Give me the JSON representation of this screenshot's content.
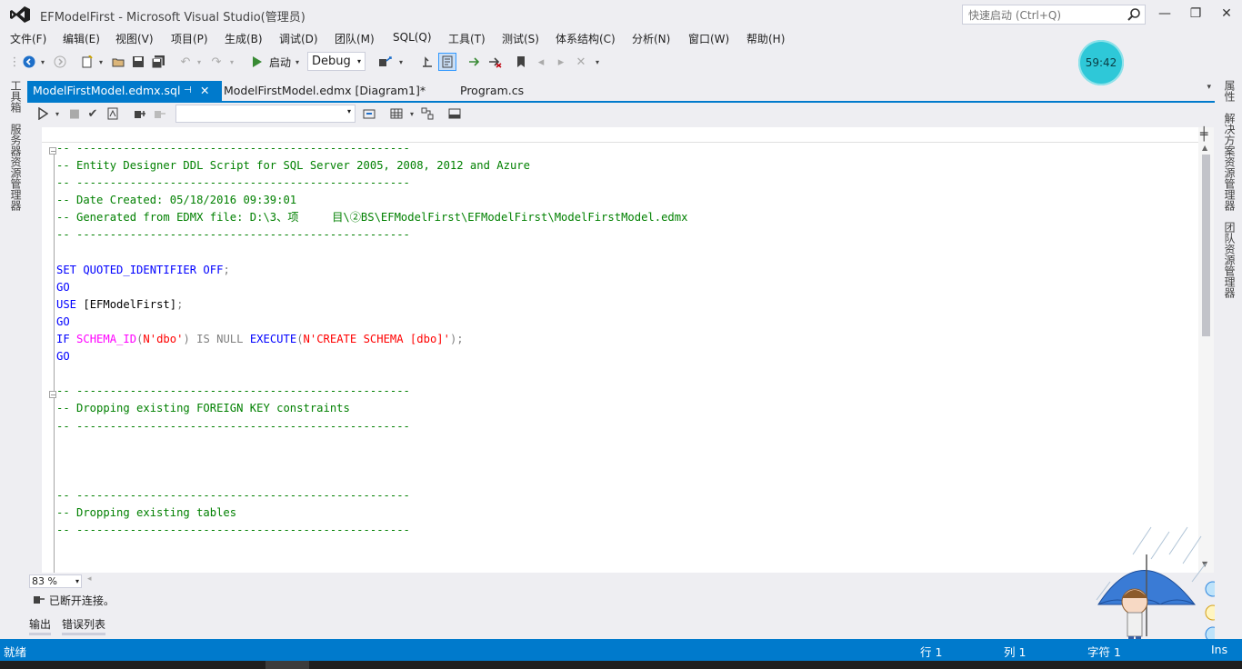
{
  "window": {
    "title": "EFModelFirst - Microsoft Visual Studio(管理员)",
    "quick_launch_placeholder": "快速启动 (Ctrl+Q)",
    "minimize": "—",
    "restore": "❐",
    "close": "✕"
  },
  "menu": [
    "文件(F)",
    "编辑(E)",
    "视图(V)",
    "项目(P)",
    "生成(B)",
    "调试(D)",
    "团队(M)",
    "SQL(Q)",
    "工具(T)",
    "测试(S)",
    "体系结构(C)",
    "分析(N)",
    "窗口(W)",
    "帮助(H)"
  ],
  "toolbar": {
    "start_label": "启动",
    "configuration": "Debug"
  },
  "timer": "59:42",
  "left_rail": [
    "工具箱",
    "服务器资源管理器"
  ],
  "right_rail": [
    "属性",
    "解决方案资源管理器",
    "团队资源管理器"
  ],
  "tabs": [
    {
      "label": "ModelFirstModel.edmx.sql",
      "active": true
    },
    {
      "label": "ModelFirstModel.edmx [Diagram1]*",
      "active": false
    },
    {
      "label": "Program.cs",
      "active": false
    }
  ],
  "editor": {
    "database_select": "",
    "zoom": "83 %",
    "lines": [
      {
        "parts": [
          {
            "t": "-- --------------------------------------------------",
            "c": "com"
          }
        ]
      },
      {
        "parts": [
          {
            "t": "-- Entity Designer DDL Script for SQL Server 2005, 2008, 2012 and Azure",
            "c": "com"
          }
        ]
      },
      {
        "parts": [
          {
            "t": "-- --------------------------------------------------",
            "c": "com"
          }
        ]
      },
      {
        "parts": [
          {
            "t": "-- Date Created: 05/18/2016 09:39:01",
            "c": "com"
          }
        ]
      },
      {
        "parts": [
          {
            "t": "-- Generated from EDMX file: D:\\3、项     目\\②BS\\EFModelFirst\\EFModelFirst\\ModelFirstModel.edmx",
            "c": "com"
          }
        ]
      },
      {
        "parts": [
          {
            "t": "-- --------------------------------------------------",
            "c": "com"
          }
        ]
      },
      {
        "parts": [
          {
            "t": "",
            "c": "txt"
          }
        ]
      },
      {
        "parts": [
          {
            "t": "SET QUOTED_IDENTIFIER OFF",
            "c": "kw"
          },
          {
            "t": ";",
            "c": "op"
          }
        ]
      },
      {
        "parts": [
          {
            "t": "GO",
            "c": "kw"
          }
        ]
      },
      {
        "parts": [
          {
            "t": "USE",
            "c": "kw"
          },
          {
            "t": " [EFModelFirst]",
            "c": "txt"
          },
          {
            "t": ";",
            "c": "op"
          }
        ]
      },
      {
        "parts": [
          {
            "t": "GO",
            "c": "kw"
          }
        ]
      },
      {
        "parts": [
          {
            "t": "IF ",
            "c": "kw"
          },
          {
            "t": "SCHEMA_ID",
            "c": "fn"
          },
          {
            "t": "(",
            "c": "op"
          },
          {
            "t": "N'dbo'",
            "c": "str"
          },
          {
            "t": ") IS NULL ",
            "c": "op"
          },
          {
            "t": "EXECUTE",
            "c": "kw"
          },
          {
            "t": "(",
            "c": "op"
          },
          {
            "t": "N'CREATE SCHEMA [dbo]'",
            "c": "str"
          },
          {
            "t": ");",
            "c": "op"
          }
        ]
      },
      {
        "parts": [
          {
            "t": "GO",
            "c": "kw"
          }
        ]
      },
      {
        "parts": [
          {
            "t": "",
            "c": "txt"
          }
        ]
      },
      {
        "parts": [
          {
            "t": "-- --------------------------------------------------",
            "c": "com"
          }
        ]
      },
      {
        "parts": [
          {
            "t": "-- Dropping existing FOREIGN KEY constraints",
            "c": "com"
          }
        ]
      },
      {
        "parts": [
          {
            "t": "-- --------------------------------------------------",
            "c": "com"
          }
        ]
      },
      {
        "parts": [
          {
            "t": "",
            "c": "txt"
          }
        ]
      },
      {
        "parts": [
          {
            "t": "",
            "c": "txt"
          }
        ]
      },
      {
        "parts": [
          {
            "t": "",
            "c": "txt"
          }
        ]
      },
      {
        "parts": [
          {
            "t": "-- --------------------------------------------------",
            "c": "com"
          }
        ]
      },
      {
        "parts": [
          {
            "t": "-- Dropping existing tables",
            "c": "com"
          }
        ]
      },
      {
        "parts": [
          {
            "t": "-- --------------------------------------------------",
            "c": "com"
          }
        ]
      },
      {
        "parts": [
          {
            "t": "",
            "c": "txt"
          }
        ]
      },
      {
        "parts": [
          {
            "t": "",
            "c": "txt"
          }
        ]
      },
      {
        "parts": [
          {
            "t": "",
            "c": "txt"
          }
        ]
      },
      {
        "parts": [
          {
            "t": "-- --------------------------------------------------",
            "c": "com"
          }
        ]
      }
    ]
  },
  "connection_status": "已断开连接。",
  "bottom_tabs": [
    "输出",
    "错误列表"
  ],
  "statusbar": {
    "ready": "就绪",
    "row": "行 1",
    "col": "列 1",
    "char": "字符 1",
    "ins": "Ins"
  },
  "colors": {
    "accent": "#007ACC",
    "comment": "#008000",
    "keyword": "#0000FF",
    "function": "#FF00FF",
    "string": "#FF0000"
  }
}
